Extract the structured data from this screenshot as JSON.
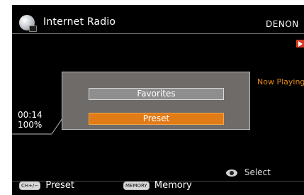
{
  "header": {
    "title": "Internet Radio",
    "brand": "DENON"
  },
  "status": {
    "now_playing": "Now Playing",
    "time": "00:14",
    "volume": "100%"
  },
  "popup": {
    "favorites_label": "Favorites",
    "preset_label": "Preset"
  },
  "footer": {
    "select_label": "Select",
    "ch_key": "CH+/−",
    "preset_label": "Preset",
    "memory_key": "MEMORY",
    "memory_label": "Memory"
  },
  "colors": {
    "accent": "#e17b16",
    "now_playing": "#e78a1c",
    "badge": "#d63a23"
  },
  "icons": [
    "globe-icon",
    "play-icon",
    "enter-dial-icon"
  ]
}
